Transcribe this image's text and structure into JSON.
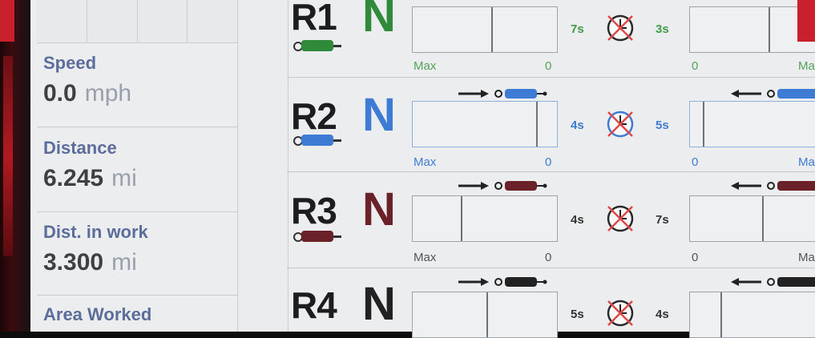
{
  "left_panel": {
    "speed": {
      "label": "Speed",
      "value": "0.0",
      "unit": "mph"
    },
    "distance": {
      "label": "Distance",
      "value": "6.245",
      "unit": "mi"
    },
    "dist_in_work": {
      "label": "Dist. in work",
      "value": "3.300",
      "unit": "mi"
    },
    "area_worked": {
      "label": "Area Worked"
    }
  },
  "rows": [
    {
      "label": "R1",
      "state": "N",
      "state_color": "#2f8a3a",
      "cyl_color": "#2f8a3a",
      "left_time": "7s",
      "right_time": "3s",
      "time_color": "#3f9a48",
      "axis_left": "Max",
      "axis_mid": "0",
      "axis_right_start": "0",
      "axis_right_end": "Ma",
      "axis_color": "#52a35a"
    },
    {
      "label": "R2",
      "state": "N",
      "state_color": "#3d7bd4",
      "cyl_color": "#3d7bd4",
      "left_time": "4s",
      "right_time": "5s",
      "time_color": "#3d7bd4",
      "axis_left": "Max",
      "axis_mid": "0",
      "axis_right_start": "0",
      "axis_right_end": "Ma",
      "axis_color": "#3d7bd4"
    },
    {
      "label": "R3",
      "state": "N",
      "state_color": "#6a2128",
      "cyl_color": "#6a2128",
      "left_time": "4s",
      "right_time": "7s",
      "time_color": "#333333",
      "axis_left": "Max",
      "axis_mid": "0",
      "axis_right_start": "0",
      "axis_right_end": "Ma",
      "axis_color": "#555555"
    },
    {
      "label": "R4",
      "state": "N",
      "state_color": "#222222",
      "cyl_color": "#222222",
      "left_time": "5s",
      "right_time": "4s",
      "time_color": "#333333"
    }
  ]
}
